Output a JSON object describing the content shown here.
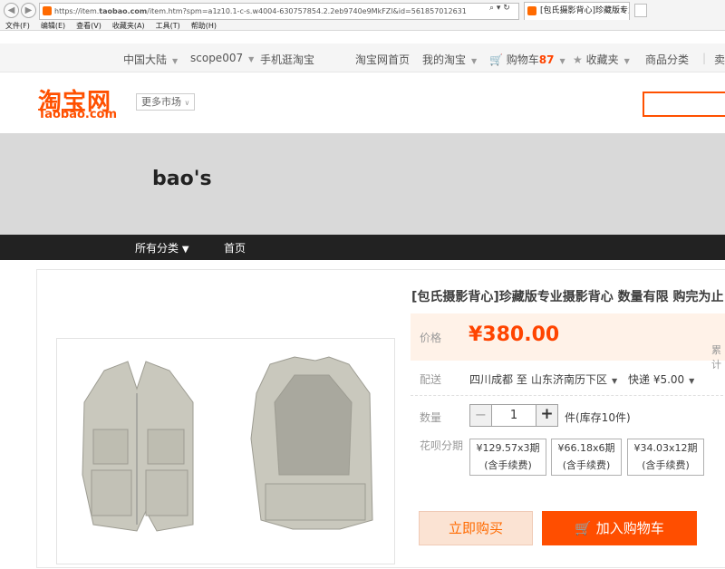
{
  "browser": {
    "url_prefix": "https://item.",
    "url_domain": "taobao.com",
    "url_rest": "/item.htm?spm=a1z10.1-c-s.w4004-630757854.2.2eb9740e9MkFZl&id=561857012631",
    "tab_title": "[包氏摄影背心]珍藏版专业...",
    "menu": [
      "文件(F)",
      "编辑(E)",
      "查看(V)",
      "收藏夹(A)",
      "工具(T)",
      "帮助(H)"
    ]
  },
  "topnav": {
    "region": "中国大陆",
    "user": "scope007",
    "mobile": "手机逛淘宝",
    "home": "淘宝网首页",
    "my_taobao": "我的淘宝",
    "cart": "购物车",
    "cart_count": "87",
    "favorites": "收藏夹",
    "categories": "商品分类",
    "seller": "卖"
  },
  "header": {
    "logo_cn": "淘宝网",
    "logo_en": "Taobao.com",
    "more_market": "更多市场"
  },
  "shop": {
    "name": "bao's",
    "nav_all": "所有分类",
    "nav_home": "首页"
  },
  "product": {
    "title": "[包氏摄影背心]珍藏版专业摄影背心 数量有限 购完为止",
    "price_label": "价格",
    "price": "¥380.00",
    "accumulated": "累计",
    "delivery_label": "配送",
    "delivery_from": "四川成都 至",
    "delivery_to": "山东济南历下区",
    "shipping": "快递 ¥5.00",
    "quantity_label": "数量",
    "quantity": "1",
    "stock": "件(库存10件)",
    "installment_label": "花呗分期",
    "installments": [
      {
        "price": "¥129.57x3期",
        "note": "(含手续费)"
      },
      {
        "price": "¥66.18x6期",
        "note": "(含手续费)"
      },
      {
        "price": "¥34.03x12期",
        "note": "(含手续费)"
      }
    ],
    "buy_now": "立即购买",
    "add_to_cart": "加入购物车"
  }
}
